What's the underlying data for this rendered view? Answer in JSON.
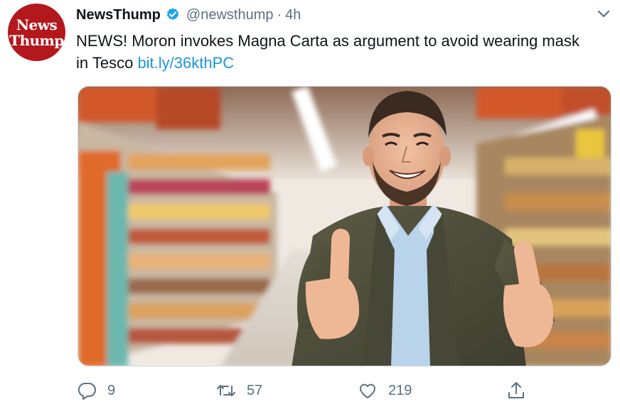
{
  "tweet": {
    "avatar": {
      "line1": "News",
      "line2": "Thump"
    },
    "display_name": "NewsThump",
    "handle": "@newsthump",
    "separator": "·",
    "timestamp": "4h",
    "text_main": "NEWS! Moron invokes Magna Carta as argument to avoid wearing mask in Tesco",
    "link_text": "bit.ly/36kthPC",
    "image_description": "Smiling bearded man giving two thumbs up in a supermarket aisle",
    "actions": {
      "reply_count": "9",
      "retweet_count": "57",
      "like_count": "219"
    }
  },
  "colors": {
    "accent_link": "#1b95e0",
    "verified_blue": "#1da1f2",
    "muted_text": "#5b7083",
    "avatar_red": "#b3181d"
  },
  "icons": [
    "verified-badge-icon",
    "chevron-down-icon",
    "reply-icon",
    "retweet-icon",
    "like-icon",
    "share-icon"
  ]
}
